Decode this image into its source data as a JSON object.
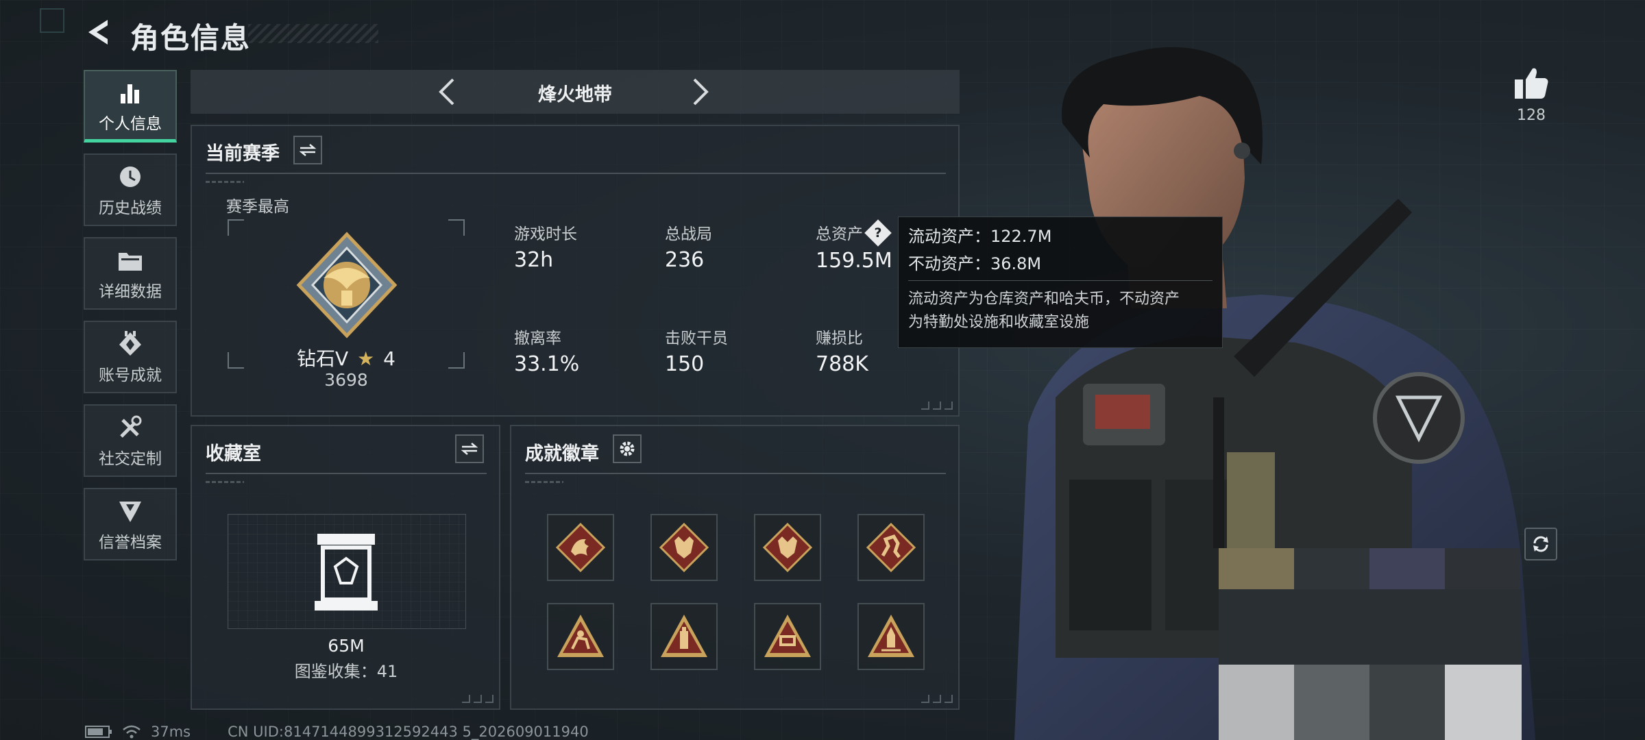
{
  "header": {
    "title": "角色信息"
  },
  "sidebar": {
    "items": [
      {
        "label": "个人信息",
        "active": true,
        "icon": "bar-chart-icon"
      },
      {
        "label": "历史战绩",
        "active": false,
        "icon": "history-clock-icon"
      },
      {
        "label": "详细数据",
        "active": false,
        "icon": "folder-icon"
      },
      {
        "label": "账号成就",
        "active": false,
        "icon": "achievement-medal-icon"
      },
      {
        "label": "社交定制",
        "active": false,
        "icon": "tools-icon"
      },
      {
        "label": "信誉档案",
        "active": false,
        "icon": "shield-emblem-icon"
      }
    ]
  },
  "mode": {
    "title": "烽火地带"
  },
  "season": {
    "title": "当前赛季",
    "best_label": "赛季最高",
    "rank_name": "钻石V",
    "rank_stars": "4",
    "rank_score": "3698",
    "stats": [
      {
        "label": "游戏时长",
        "value": "32h"
      },
      {
        "label": "总战局",
        "value": "236"
      },
      {
        "label": "总资产",
        "value": "159.5M"
      },
      {
        "label": "撤离率",
        "value": "33.1%"
      },
      {
        "label": "击败干员",
        "value": "150"
      },
      {
        "label": "赚损比",
        "value": "788K"
      }
    ],
    "help_badge": "?"
  },
  "tooltip": {
    "liquid": "流动资产：122.7M",
    "fixed": "不动资产：36.8M",
    "desc_line1": "流动资产为仓库资产和哈夫币，不动资产",
    "desc_line2": "为特勤处设施和收藏室设施"
  },
  "collection": {
    "title": "收藏室",
    "value": "65M",
    "count_text": "图鉴收集：41"
  },
  "badges": {
    "title": "成就徽章",
    "items": [
      "dragon-badge-icon",
      "wolf-badge-icon",
      "wolf-badge-icon",
      "runner-badge-icon",
      "rider-badge-icon",
      "bottle-badge-icon",
      "sign-badge-icon",
      "rocket-badge-icon"
    ]
  },
  "likes": {
    "count": "128"
  },
  "footer": {
    "ping": "37ms",
    "uid": "CN UID:8147144899312592443 5_202609011940"
  },
  "colors": {
    "accent": "#43d4a0",
    "badge_red": "#7a2a22",
    "badge_gold": "#c9a25b"
  }
}
